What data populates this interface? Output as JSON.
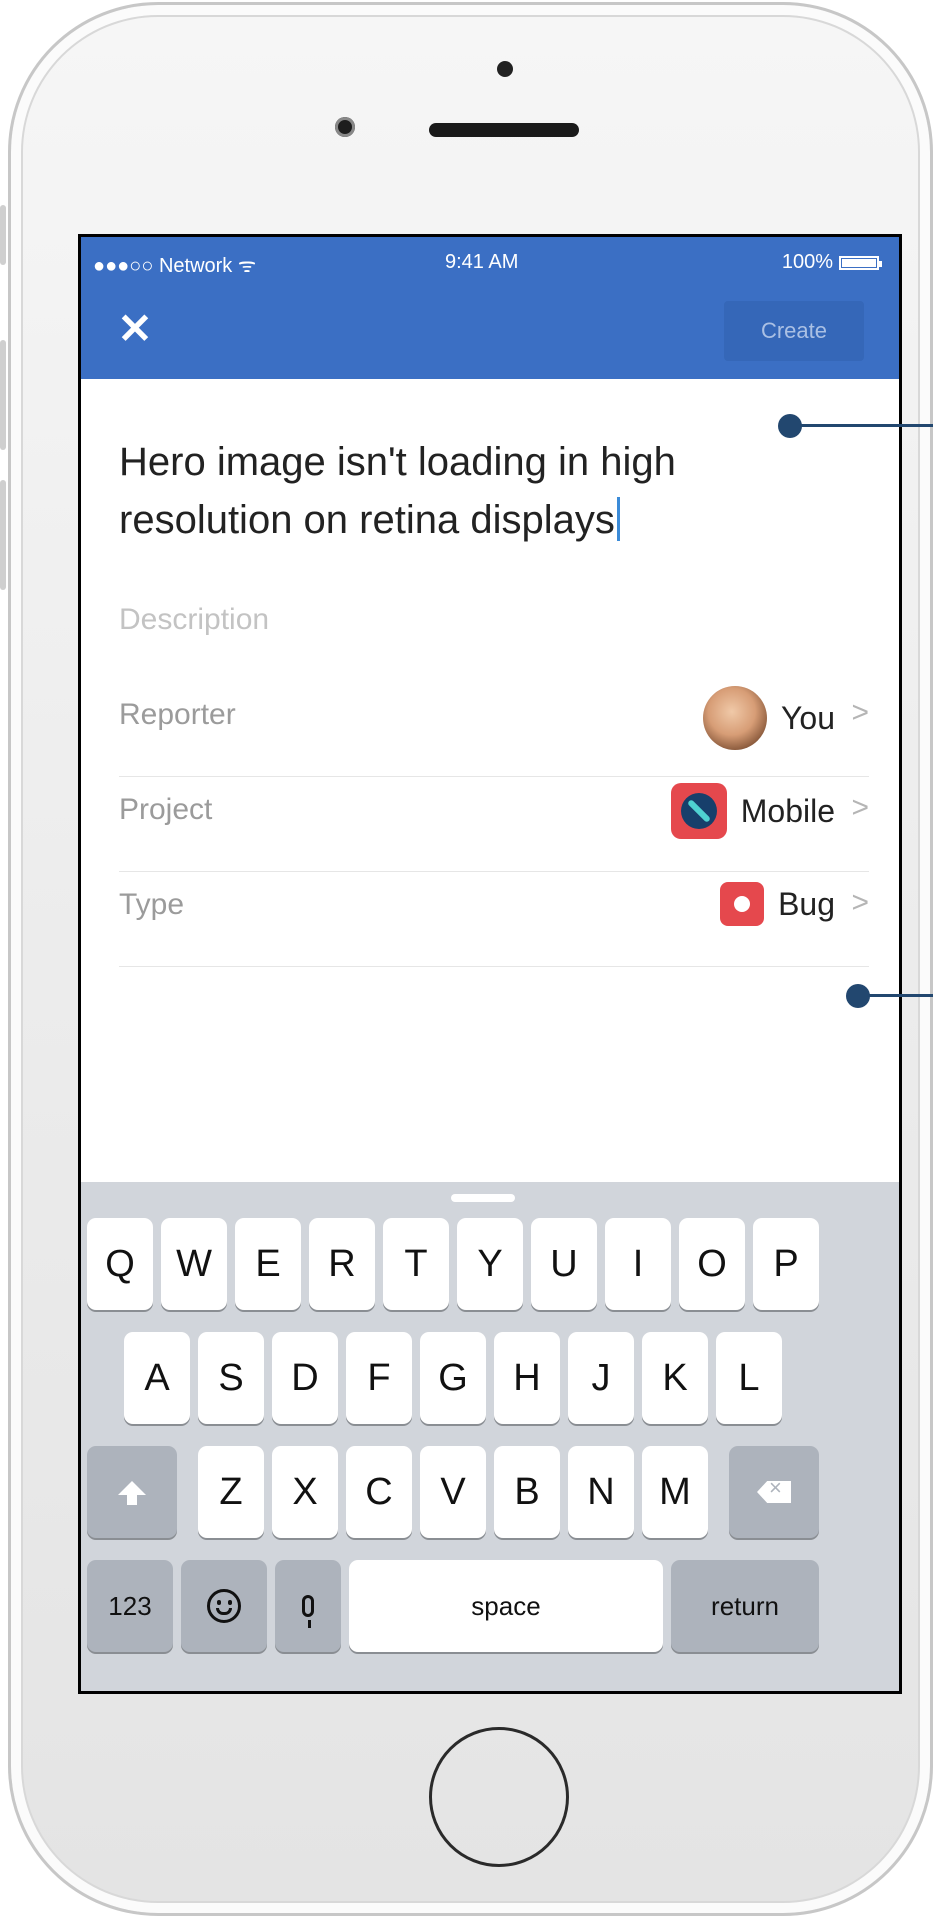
{
  "status_bar": {
    "signal": "●●●○○ Network ᯤ",
    "time": "9:41 AM",
    "battery": "100%"
  },
  "nav": {
    "close": "✕",
    "create": "Create"
  },
  "issue": {
    "title": "Hero image isn't loading in high resolution on retina displays",
    "description_placeholder": "Description"
  },
  "fields": [
    {
      "label": "Reporter",
      "value": "You",
      "icon": "avatar"
    },
    {
      "label": "Project",
      "value": "Mobile",
      "icon": "project-icon"
    },
    {
      "label": "Type",
      "value": "Bug",
      "icon": "bug-icon"
    }
  ],
  "chevron": ">",
  "keyboard": {
    "row1": [
      "Q",
      "W",
      "E",
      "R",
      "T",
      "Y",
      "U",
      "I",
      "O",
      "P"
    ],
    "row2": [
      "A",
      "S",
      "D",
      "F",
      "G",
      "H",
      "J",
      "K",
      "L"
    ],
    "row3": [
      "Z",
      "X",
      "C",
      "V",
      "B",
      "N",
      "M"
    ],
    "numbers": "123",
    "space": "space",
    "return": "return"
  },
  "colors": {
    "nav_bar": "#3b6fc4",
    "create_button": "#3567b8",
    "annotation": "#22476f"
  }
}
